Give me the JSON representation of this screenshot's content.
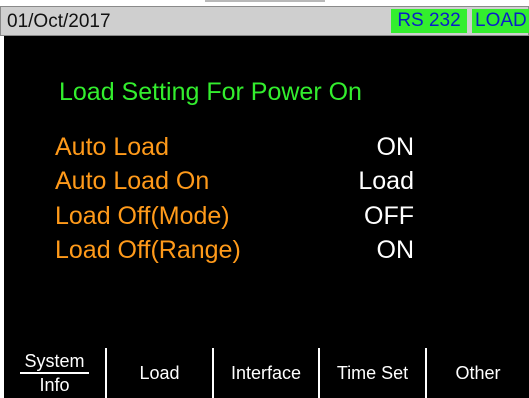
{
  "status_bar": {
    "date": "01/Oct/2017",
    "interface_badge": "RS 232",
    "mode_badge": "LOAD",
    "badge_color": "#33ee2e",
    "badge_text_color": "#0a1ec8"
  },
  "screen": {
    "title": "Load Setting For Power On",
    "title_color": "#33ee2e",
    "label_color": "#ff9a1a",
    "value_color": "#ffffff",
    "settings": [
      {
        "label": "Auto Load",
        "value": "ON"
      },
      {
        "label": "Auto Load On",
        "value": "Load"
      },
      {
        "label": "Load Off(Mode)",
        "value": "OFF"
      },
      {
        "label": "Load Off(Range)",
        "value": "ON"
      }
    ]
  },
  "softkeys": [
    {
      "line1": "System",
      "line2": "Info"
    },
    {
      "label": "Load"
    },
    {
      "label": "Interface"
    },
    {
      "label": "Time Set"
    },
    {
      "label": "Other"
    }
  ]
}
